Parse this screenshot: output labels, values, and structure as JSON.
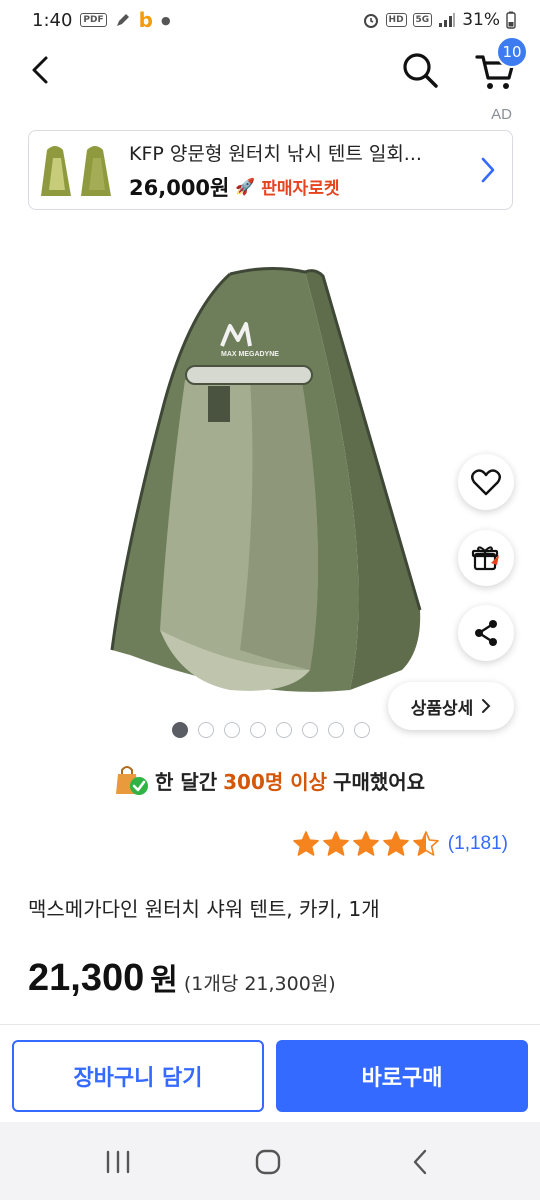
{
  "status_bar": {
    "time": "1:40",
    "battery": "31%"
  },
  "header": {
    "cart_count": "10"
  },
  "ad": {
    "label": "AD",
    "title": "KFP 양문형 원터치 낚시 텐트 일회...",
    "price": "26,000원",
    "badge": "판매자로켓"
  },
  "gallery": {
    "image_count": 8,
    "active_index": 0,
    "detail_label": "상품상세"
  },
  "purchase_info": {
    "prefix": "한 달간",
    "highlight": "300명 이상",
    "suffix": "구매했어요"
  },
  "rating": {
    "stars": 4.5,
    "review_count": "(1,181)"
  },
  "product": {
    "name": "맥스메가다인 원터치 샤워 텐트, 카키, 1개",
    "price": "21,300",
    "currency": "원",
    "unit_price": "(1개당 21,300원)",
    "logo_text": "MAX MEGADYNE"
  },
  "actions": {
    "add_to_cart": "장바구니 담기",
    "buy_now": "바로구매"
  },
  "colors": {
    "accent": "#346aff",
    "badge": "#3c7cf0",
    "highlight": "#d4570a",
    "star": "#f5841f",
    "tent": "#6f7e5a"
  }
}
